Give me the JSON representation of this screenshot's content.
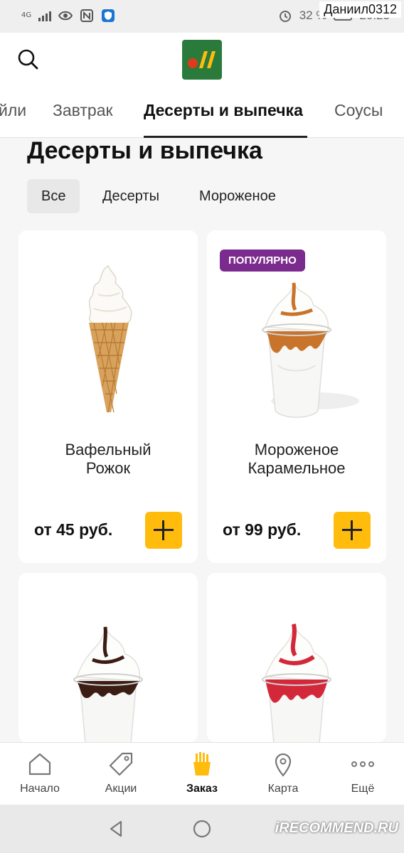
{
  "status_bar": {
    "network": "4G",
    "battery_percent": "32 %",
    "time": "20:23",
    "overlay_user": "Даниил0312"
  },
  "header": {
    "search_icon": "search-icon",
    "logo_icon": "brand-logo-icon",
    "brand_color": "#2a7a3b"
  },
  "category_tabs": [
    {
      "label": "йли",
      "active": false
    },
    {
      "label": "Завтрак",
      "active": false
    },
    {
      "label": "Десерты и выпечка",
      "active": true
    },
    {
      "label": "Соусы",
      "active": false
    }
  ],
  "page_title": "Десерты и выпечка",
  "filters": [
    {
      "label": "Все",
      "active": true
    },
    {
      "label": "Десерты",
      "active": false
    },
    {
      "label": "Мороженое",
      "active": false
    }
  ],
  "products": [
    {
      "name": "Вафельный\nРожок",
      "price": "от 45 руб.",
      "badge": "",
      "image": "waffle-cone-icon"
    },
    {
      "name": "Мороженое\nКарамельное",
      "price": "от 99 руб.",
      "badge": "ПОПУЛЯРНО",
      "image": "caramel-sundae-icon"
    },
    {
      "name": "",
      "price": "",
      "badge": "",
      "image": "chocolate-sundae-icon"
    },
    {
      "name": "",
      "price": "",
      "badge": "",
      "image": "strawberry-sundae-icon"
    }
  ],
  "bottom_nav": [
    {
      "label": "Начало",
      "icon": "home-icon",
      "active": false
    },
    {
      "label": "Акции",
      "icon": "tag-icon",
      "active": false
    },
    {
      "label": "Заказ",
      "icon": "fries-icon",
      "active": true
    },
    {
      "label": "Карта",
      "icon": "map-pin-icon",
      "active": false
    },
    {
      "label": "Ещё",
      "icon": "more-icon",
      "active": false
    }
  ],
  "watermark": "iRECOMMEND.RU",
  "colors": {
    "accent_yellow": "#ffbc0d",
    "badge_purple": "#7b2b8e",
    "logo_red": "#e03a1e"
  }
}
